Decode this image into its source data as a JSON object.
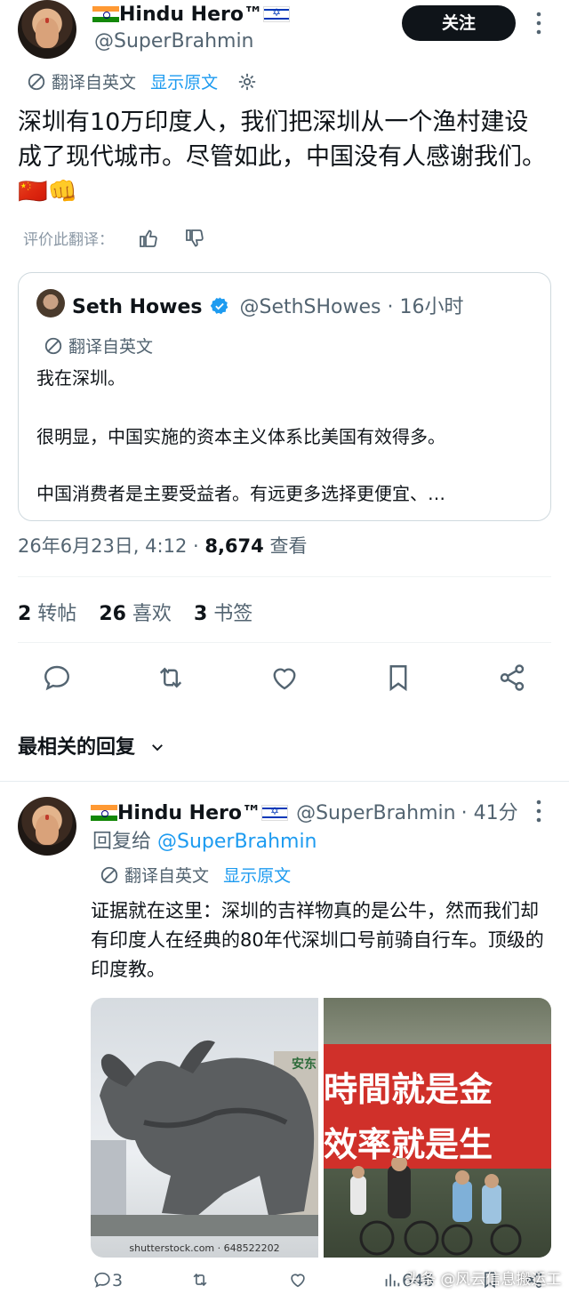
{
  "post": {
    "display_name": "Hindu Hero™",
    "handle": "@SuperBrahmin",
    "follow_label": "关注",
    "translated_from": "翻译自英文",
    "show_original": "显示原文",
    "text": "深圳有10万印度人，我们把深圳从一个渔村建设成了现代城市。尽管如此，中国没有人感谢我们。🇨🇳👊",
    "rate_translation": "评价此翻译："
  },
  "quote": {
    "name": "Seth Howes",
    "handle": "@SethSHowes",
    "time": "· 16小时",
    "translated_from": "翻译自英文",
    "para1": "我在深圳。",
    "para2": "很明显，中国实施的资本主义体系比美国有效得多。",
    "para3": "中国消费者是主要受益者。有远更多选择更便宜、…"
  },
  "meta": {
    "date": "26年6月23日, 4:12 · ",
    "views_count": "8,674",
    "views_label": " 查看"
  },
  "stats": {
    "reposts_count": "2",
    "reposts_label": " 转帖",
    "likes_count": "26",
    "likes_label": " 喜欢",
    "bookmarks_count": "3",
    "bookmarks_label": " 书签"
  },
  "replies": {
    "sort_label": "最相关的回复"
  },
  "reply": {
    "display_name": "Hindu Hero™",
    "handle": "@SuperBrahmin",
    "time": "· 41分",
    "replying_to_label": "回复给 ",
    "replying_to_handle": "@SuperBrahmin",
    "translated_from": "翻译自英文",
    "show_original": "显示原文",
    "text": "证据就在这里：深圳的吉祥物真的是公牛，然而我们却有印度人在经典的80年代深圳口号前骑自行车。顶级的印度教。",
    "photo1_building_sign": "安东",
    "photo1_caption": "shutterstock.com · 648522202",
    "photo2_banner_line1": "時間就是金",
    "photo2_banner_line2": "效率就是生",
    "replies_count": "3",
    "views_count": "646"
  },
  "watermark": "头条 @风云信息搬运工",
  "colors": {
    "accent": "#1d9bf0",
    "text": "#0f1419",
    "secondary": "#536471"
  }
}
